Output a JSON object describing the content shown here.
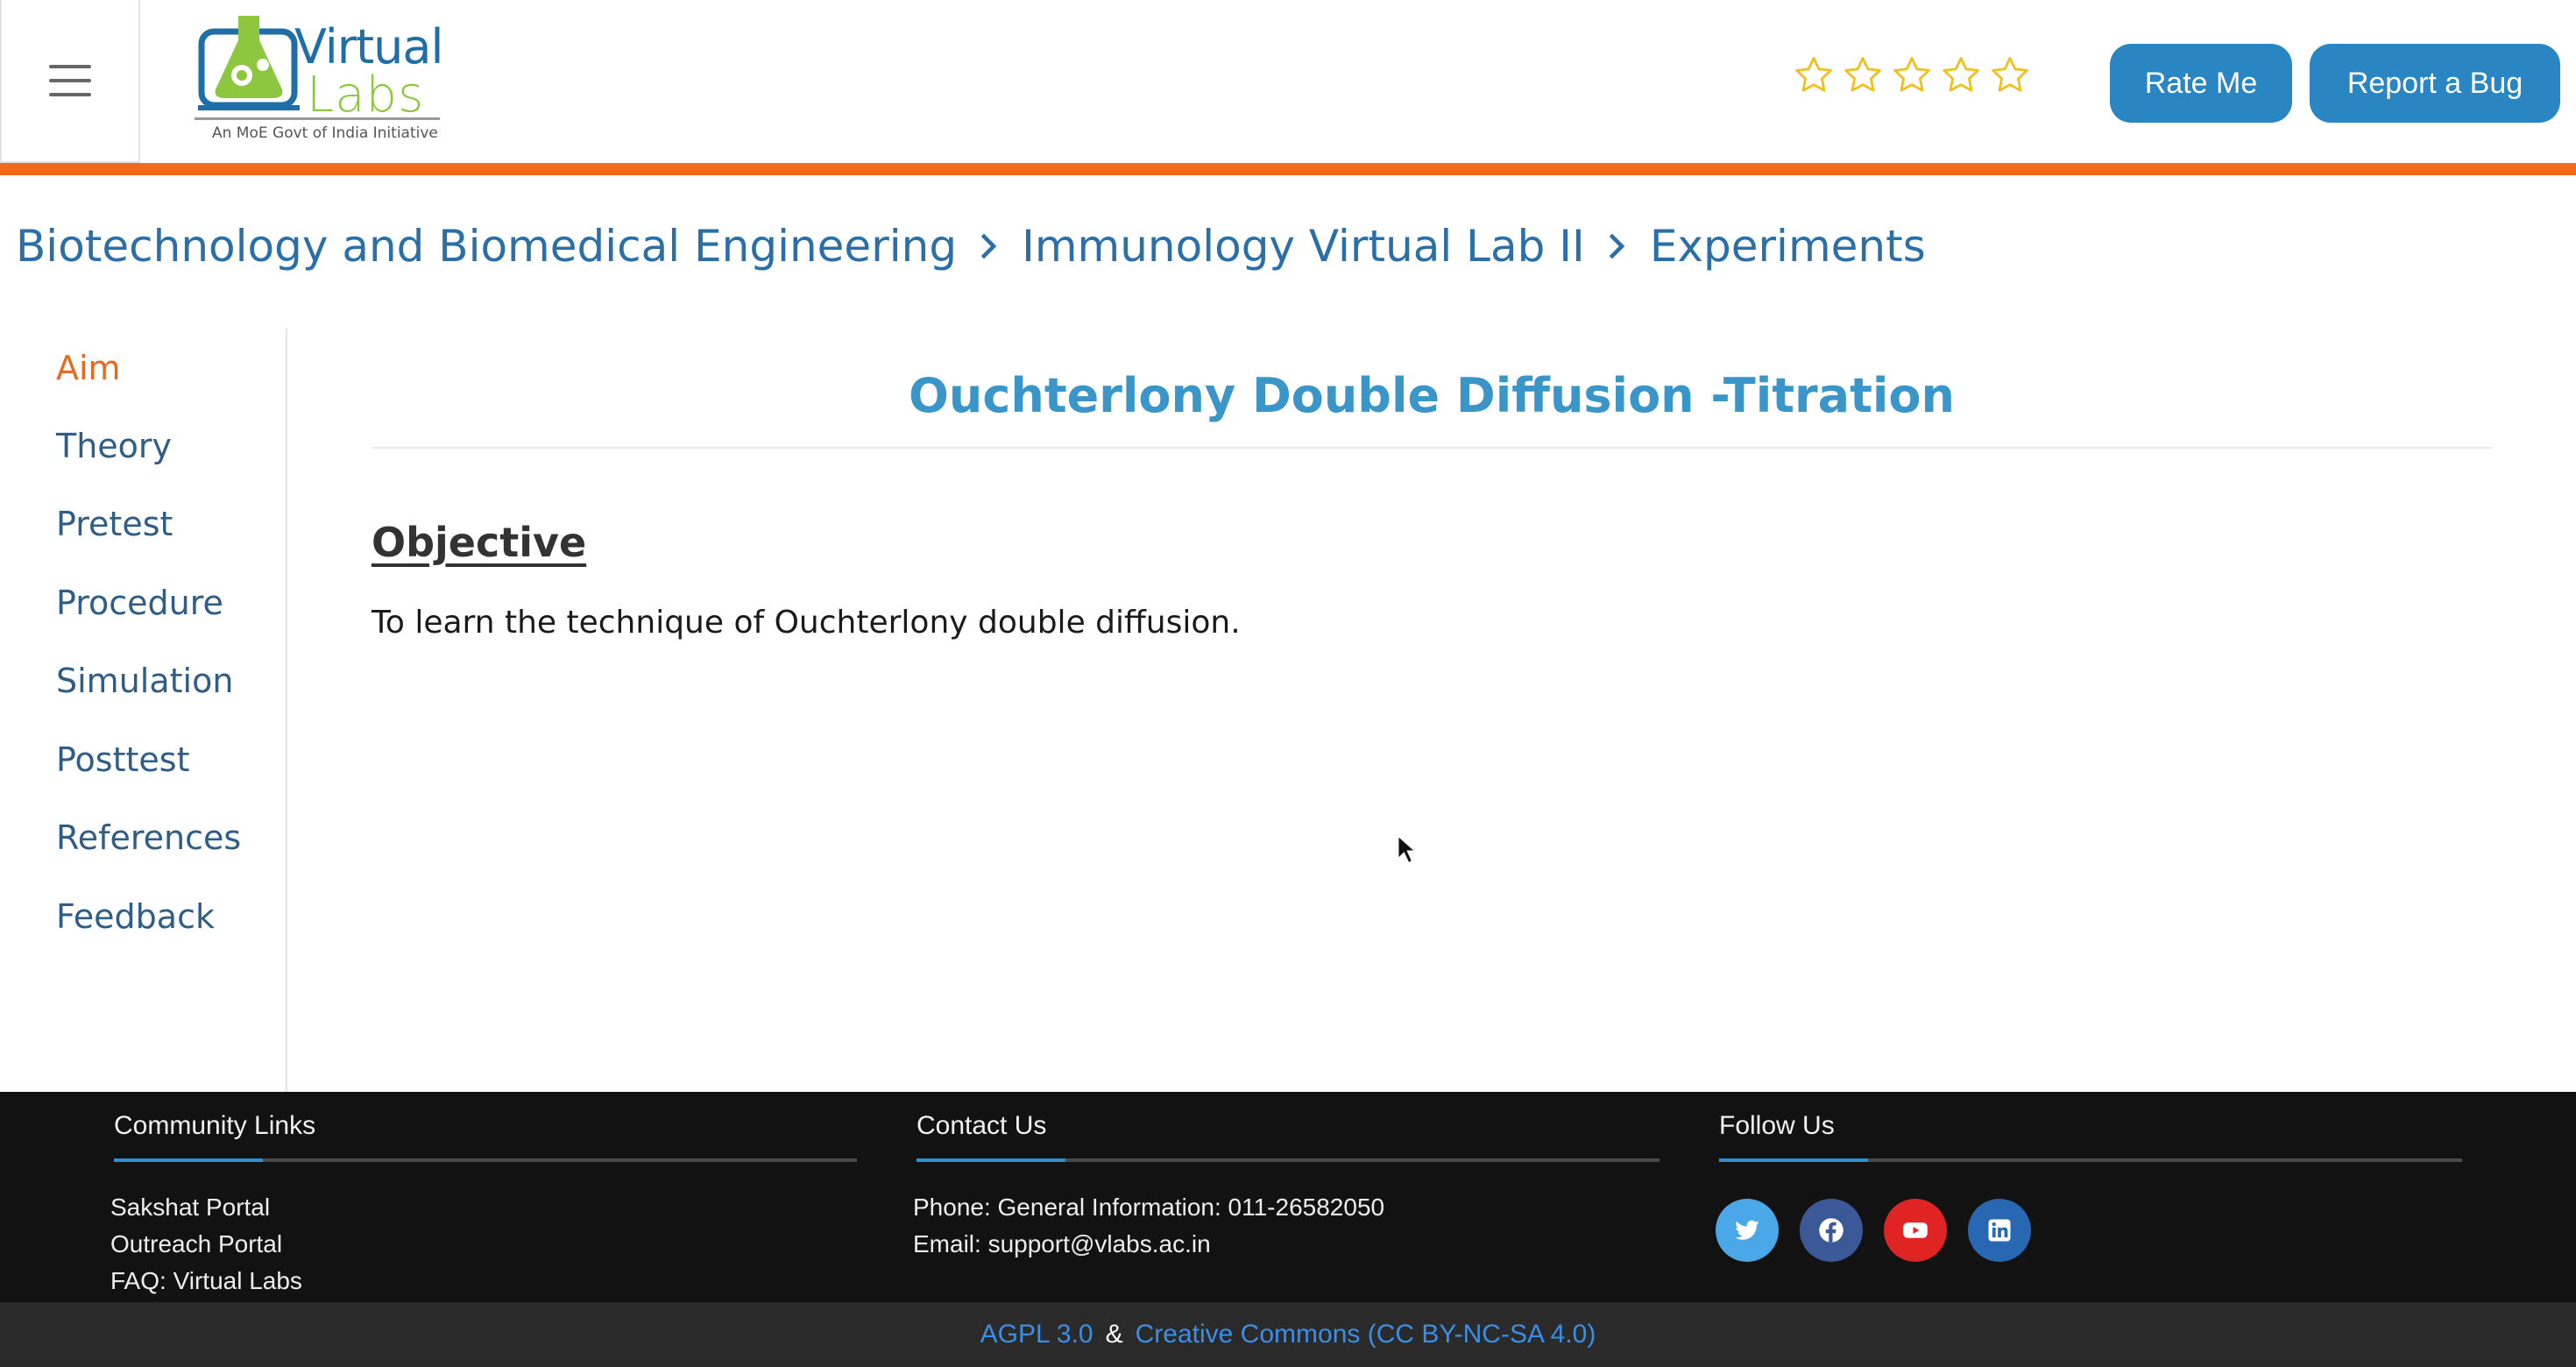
{
  "header": {
    "logo": {
      "line1": "Virtual",
      "line2": "Labs",
      "tagline": "An MoE Govt of India Initiative"
    },
    "rating": {
      "max_stars": 5,
      "filled": 0
    },
    "rate_button": "Rate Me",
    "bug_button": "Report a Bug",
    "colors": {
      "accent_bar": "#f26b1d",
      "button": "#2a86c3",
      "star": "#f2c01e"
    }
  },
  "breadcrumb": [
    "Biotechnology and Biomedical Engineering",
    "Immunology Virtual Lab II",
    "Experiments"
  ],
  "sidebar": {
    "items": [
      {
        "label": "Aim",
        "active": true
      },
      {
        "label": "Theory"
      },
      {
        "label": "Pretest"
      },
      {
        "label": "Procedure"
      },
      {
        "label": "Simulation"
      },
      {
        "label": "Posttest"
      },
      {
        "label": "References"
      },
      {
        "label": "Feedback"
      }
    ]
  },
  "main": {
    "title": "Ouchterlony Double Diffusion -Titration",
    "section_heading": "Objective",
    "section_text": "To learn the technique of Ouchterlony double diffusion."
  },
  "footer": {
    "community": {
      "heading": "Community Links",
      "links": [
        "Sakshat Portal",
        "Outreach Portal",
        "FAQ: Virtual Labs"
      ]
    },
    "contact": {
      "heading": "Contact Us",
      "phone": "Phone: General Information: 011-26582050",
      "email": "Email: support@vlabs.ac.in"
    },
    "follow": {
      "heading": "Follow Us",
      "networks": [
        "twitter-icon",
        "facebook-icon",
        "youtube-icon",
        "linkedin-icon"
      ]
    },
    "license": {
      "agpl": "AGPL 3.0",
      "separator": "&",
      "cc": "Creative Commons (CC BY-NC-SA 4.0)"
    }
  }
}
